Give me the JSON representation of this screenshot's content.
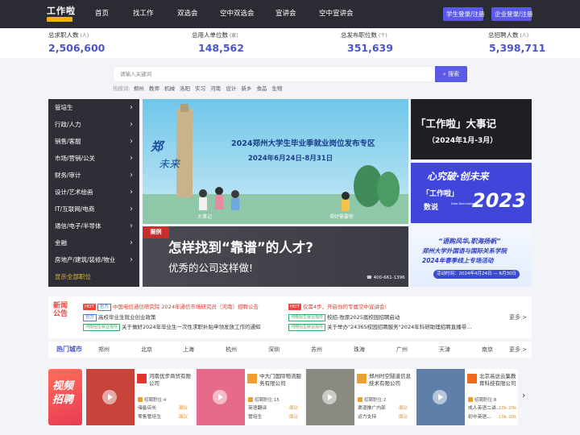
{
  "header": {
    "logo_text": "工作啦",
    "logo_sub": "",
    "nav": [
      "首页",
      "找工作",
      "双选会",
      "空中双选会",
      "宣讲会",
      "空中宣讲会"
    ],
    "student_login": "学生登录/注册",
    "company_login": "企业登录/注册"
  },
  "stats": [
    {
      "label": "总求职人数",
      "unit": "(人)",
      "value": "2,506,600"
    },
    {
      "label": "总用人单位数",
      "unit": "(家)",
      "value": "148,562"
    },
    {
      "label": "总发布职位数",
      "unit": "(个)",
      "value": "351,639"
    },
    {
      "label": "总招聘人数",
      "unit": "(人)",
      "value": "5,398,711"
    }
  ],
  "search": {
    "placeholder": "请输入关键词",
    "button": "搜索",
    "hot_label": "热搜词:",
    "hot_words": [
      "郑州",
      "教师",
      "机械",
      "洛阳",
      "实习",
      "河南",
      "设计",
      "新乡",
      "食品",
      "生物"
    ]
  },
  "categories": [
    "管培生",
    "行政/人力",
    "销售/客服",
    "市场/营销/公关",
    "财务/审计",
    "设计/艺术绘画",
    "IT/互联网/电商",
    "通信/电子/半导体",
    "金融",
    "房地产/建筑/装修/物业"
  ],
  "show_all": "显示全部职位",
  "banners": {
    "main": {
      "title": "2024郑州大学生毕业季就业岗位发布专区",
      "dates": "2024年6月24日-8月31日",
      "calligraphy_1": "郑",
      "calligraphy_2": "未来",
      "caption_left": "大事记",
      "caption_right": "郑好需要你"
    },
    "case": {
      "tag": "案例",
      "headline": "怎样找到“靠谱”的人才?",
      "sub": "优秀的公司这样做!",
      "phone": "400-661-1396"
    },
    "events": {
      "line1": "「工作啦」大事记",
      "line2": "（2024年1月-3月）"
    },
    "data": {
      "line1": "心究破·创未来",
      "line2": "「工作啦」",
      "line3": "数说",
      "year": "2023",
      "data_desc": "Data Description"
    },
    "uni": {
      "line1": "“语购风华,职海扬帆”",
      "line2": "郑州大学外国语与国际关系学院",
      "line3": "2024年春季线上专场活动",
      "date": "活动时间：2024年4月24日 — 6月30日"
    }
  },
  "news": {
    "title": "新闻公告",
    "col1": [
      {
        "badges": [
          "HOT",
          "官方"
        ],
        "text": "中国电信通信研究院 2024年通信市场研究员（河南）招聘公告",
        "color": "red"
      },
      {
        "badges": [
          "官方"
        ],
        "text": "高校毕业生就业创业政策",
        "color": "dark"
      },
      {
        "badges": [
          "河南招生就业指导"
        ],
        "text": "关于做好2024年毕业生一次性求职补贴申领发放工作的通知",
        "color": "dark"
      }
    ],
    "col2": [
      {
        "badges": [
          "HOT"
        ],
        "text": "仅需4步，开启你的专属空中宣讲会!",
        "color": "red"
      },
      {
        "badges": [
          "河南招生就业指导"
        ],
        "text": "校招-牧原2025届校园招聘启动",
        "color": "dark"
      },
      {
        "badges": [
          "河南招生就业指导"
        ],
        "text": "关于举办\"24365校园招聘服务\"2024年科研助理招聘直播带...",
        "color": "dark"
      }
    ],
    "more": "更多 >"
  },
  "cities": {
    "title": "热门城市",
    "items": [
      "郑州",
      "北京",
      "上海",
      "杭州",
      "深圳",
      "苏州",
      "珠海",
      "广州",
      "天津",
      "南京"
    ],
    "more": "更多 >"
  },
  "video_jobs": {
    "label_1": "视频",
    "label_2": "招聘",
    "cards": [
      {
        "company": "河南优步商贸有限公司",
        "count": "招聘职位:4",
        "jobs": [
          {
            "title": "储备店长",
            "salary": "面议"
          },
          {
            "title": "零售管培生",
            "salary": "面议"
          }
        ],
        "logo_color": "#e7332f",
        "thumb": "#c8443a"
      },
      {
        "company": "中大门国际物流服务有限公司",
        "count": "招聘职位:15",
        "jobs": [
          {
            "title": "英语翻译",
            "salary": "面议"
          },
          {
            "title": "管培生",
            "salary": "面议"
          }
        ],
        "logo_color": "#f29b2f",
        "thumb": "#e66b8a"
      },
      {
        "company": "郑州时空隧道信息技术有限公司",
        "count": "招聘职位:2",
        "jobs": [
          {
            "title": "渠道推广内部",
            "salary": "面议"
          },
          {
            "title": "运力支持",
            "salary": "面议"
          }
        ],
        "logo_color": "#e7a12f",
        "thumb": "#8a8a80"
      },
      {
        "company": "北京高途云集教育科技有限公司",
        "count": "招聘职位:8",
        "jobs": [
          {
            "title": "成人英语二讲...",
            "salary": "10k-20k"
          },
          {
            "title": "初中英语...",
            "salary": "10k-20k"
          }
        ],
        "logo_color": "#f06a1c",
        "thumb": "#5d7fa8"
      }
    ]
  }
}
